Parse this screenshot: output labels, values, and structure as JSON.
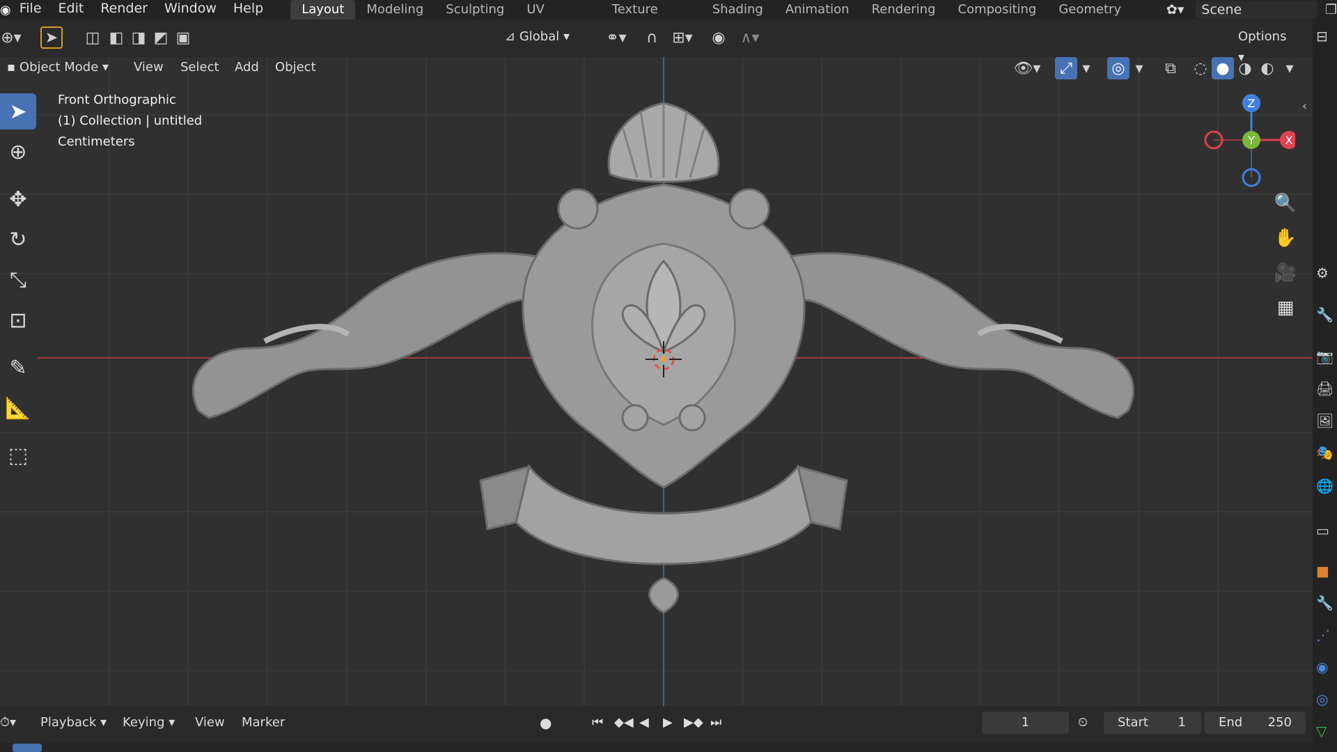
{
  "menubar": {
    "items": [
      "File",
      "Edit",
      "Render",
      "Window",
      "Help"
    ],
    "workspaces": [
      "Layout",
      "Modeling",
      "Sculpting",
      "UV Editing",
      "Texture Paint",
      "Shading",
      "Animation",
      "Rendering",
      "Compositing",
      "Geometry Nod"
    ],
    "active_workspace": "Layout",
    "scene": "Scene"
  },
  "header": {
    "orientation": "Global",
    "options": "Options"
  },
  "viewport_header": {
    "mode": "Object Mode",
    "menus": [
      "View",
      "Select",
      "Add",
      "Object"
    ]
  },
  "viewport": {
    "view_name": "Front Orthographic",
    "collection": "(1) Collection | untitled",
    "units": "Centimeters",
    "gizmo": {
      "z": "Z",
      "y": "Y",
      "x": "X"
    }
  },
  "timeline": {
    "menus": [
      "Playback",
      "Keying",
      "View",
      "Marker"
    ],
    "current_frame": "1",
    "start_label": "Start",
    "start_value": "1",
    "end_label": "End",
    "end_value": "250"
  },
  "colors": {
    "accent": "#4772b3",
    "x_axis": "#e0414f",
    "y_axis": "#7ab83a",
    "z_axis": "#3f7fe0",
    "viewport_bg": "#303030"
  }
}
